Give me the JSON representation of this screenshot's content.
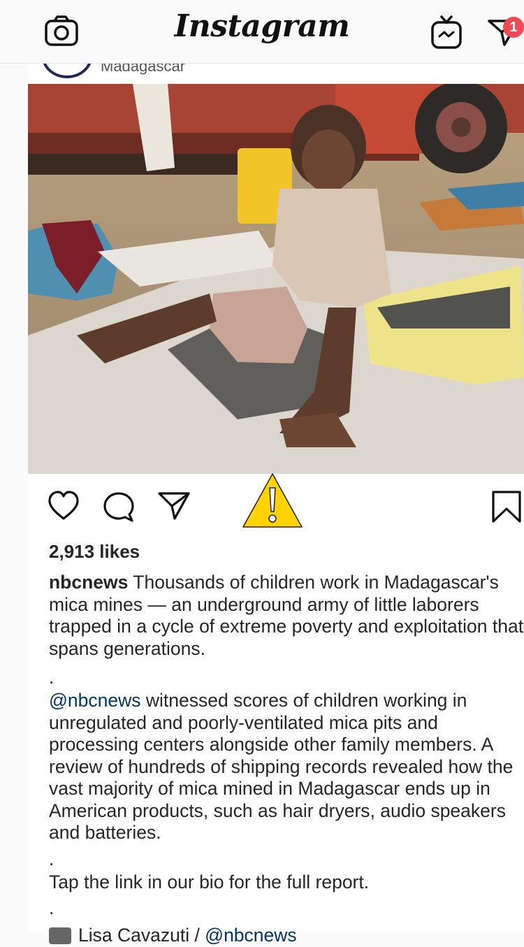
{
  "app": {
    "title": "Instagram",
    "notification_count": "1"
  },
  "post": {
    "location": "Madagascar",
    "likes": "2,913 likes",
    "username": "nbcnews",
    "caption_intro": " Thousands of children work in Madagascar's mica mines — an underground army of little laborers trapped in a cycle of extreme poverty and exploitation that spans generations.",
    "dot": ".",
    "mention": "@nbcnews",
    "paragraph2": " witnessed scores of children working in unregulated and poorly-ventilated mica pits and processing centers alongside other family members. A review of hundreds of shipping records revealed how the vast majority of mica mined in Madagascar ends up in American products, such as hair dryers, audio speakers and batteries.",
    "paragraph3": "Tap the link in our bio for the full report.",
    "credit_name": "Lisa Cavazuti / ",
    "credit_mention": "@nbcnews"
  }
}
